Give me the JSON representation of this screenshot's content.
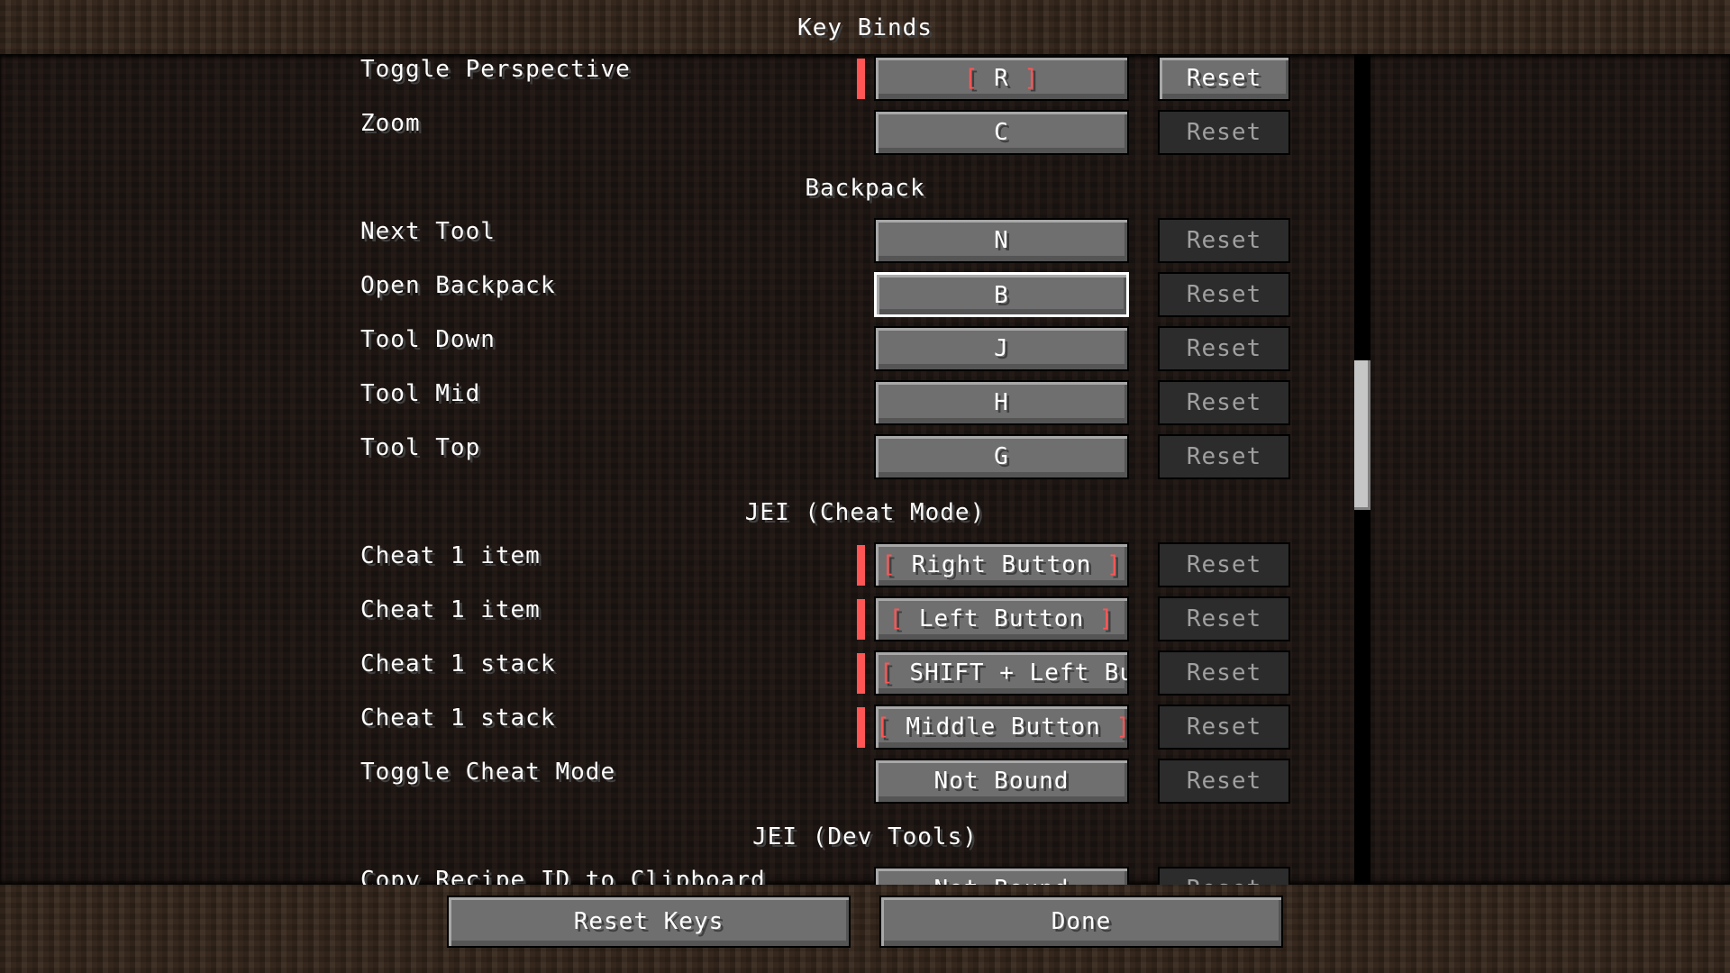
{
  "window": {
    "title": "Key Binds"
  },
  "rows": [
    {
      "type": "bind",
      "label": "Toggle Perspective",
      "key": "R",
      "conflict": true,
      "reset_enabled": true,
      "reset": "Reset"
    },
    {
      "type": "bind",
      "label": "Zoom",
      "key": "C",
      "conflict": false,
      "reset_enabled": false,
      "reset": "Reset"
    },
    {
      "type": "section",
      "label": "Backpack"
    },
    {
      "type": "bind",
      "label": "Next Tool",
      "key": "N",
      "conflict": false,
      "reset_enabled": false,
      "reset": "Reset"
    },
    {
      "type": "bind",
      "label": "Open Backpack",
      "key": "B",
      "conflict": false,
      "reset_enabled": false,
      "reset": "Reset",
      "hovered": true
    },
    {
      "type": "bind",
      "label": "Tool Down",
      "key": "J",
      "conflict": false,
      "reset_enabled": false,
      "reset": "Reset"
    },
    {
      "type": "bind",
      "label": "Tool Mid",
      "key": "H",
      "conflict": false,
      "reset_enabled": false,
      "reset": "Reset"
    },
    {
      "type": "bind",
      "label": "Tool Top",
      "key": "G",
      "conflict": false,
      "reset_enabled": false,
      "reset": "Reset"
    },
    {
      "type": "section",
      "label": "JEI (Cheat Mode)"
    },
    {
      "type": "bind",
      "label": "Cheat 1 item",
      "key": "Right Button",
      "conflict": true,
      "reset_enabled": false,
      "reset": "Reset"
    },
    {
      "type": "bind",
      "label": "Cheat 1 item",
      "key": "Left Button",
      "conflict": true,
      "reset_enabled": false,
      "reset": "Reset"
    },
    {
      "type": "bind",
      "label": "Cheat 1 stack",
      "key": "SHIFT + Left But",
      "conflict": true,
      "reset_enabled": false,
      "reset": "Reset",
      "truncated_left": true
    },
    {
      "type": "bind",
      "label": "Cheat 1 stack",
      "key": "Middle Button",
      "conflict": true,
      "reset_enabled": false,
      "reset": "Reset"
    },
    {
      "type": "bind",
      "label": "Toggle Cheat Mode",
      "key": "Not Bound",
      "conflict": false,
      "reset_enabled": false,
      "reset": "Reset"
    },
    {
      "type": "section",
      "label": "JEI (Dev Tools)"
    },
    {
      "type": "bind",
      "label": "Copy Recipe ID to Clipboard",
      "key": "Not Bound",
      "conflict": false,
      "reset_enabled": false,
      "reset": "Reset"
    }
  ],
  "scrollbar": {
    "position_fraction": 0.45,
    "visible_fraction": 0.18
  },
  "footer": {
    "reset_keys": "Reset Keys",
    "done": "Done"
  },
  "colors": {
    "conflict": "#ff5555",
    "text": "#ffffff",
    "disabled_text": "#a0a0a0"
  }
}
